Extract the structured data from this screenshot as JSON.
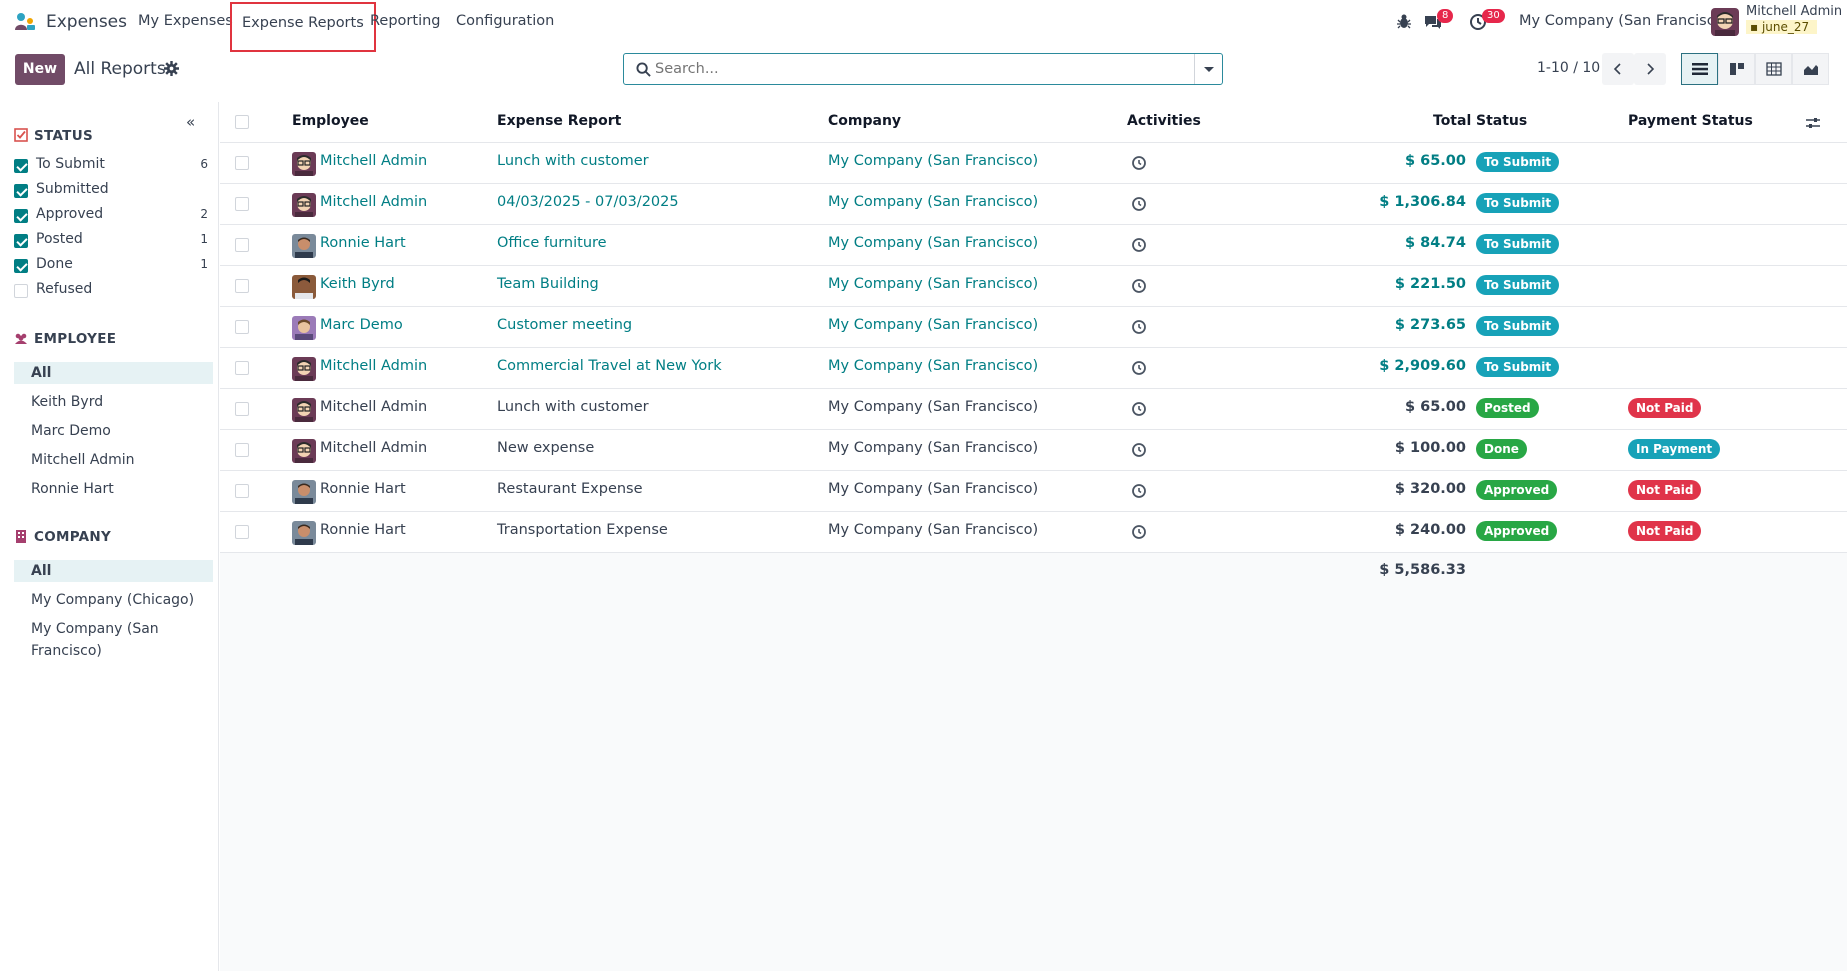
{
  "app": {
    "name": "Expenses",
    "menu": [
      "My Expenses",
      "Expense Reports",
      "Reporting",
      "Configuration"
    ],
    "active_menu": "Expense Reports"
  },
  "systray": {
    "messages_count": "8",
    "activities_count": "30",
    "company": "My Company (San Francisco)",
    "user_name": "Mitchell Admin",
    "database": "june_27"
  },
  "control": {
    "new_label": "New",
    "title": "All Reports",
    "search_placeholder": "Search...",
    "pager": "1-10 / 10"
  },
  "sidebar": {
    "status_title": "STATUS",
    "status_items": [
      {
        "label": "To Submit",
        "count": "6",
        "checked": true
      },
      {
        "label": "Submitted",
        "count": "",
        "checked": true
      },
      {
        "label": "Approved",
        "count": "2",
        "checked": true
      },
      {
        "label": "Posted",
        "count": "1",
        "checked": true
      },
      {
        "label": "Done",
        "count": "1",
        "checked": true
      },
      {
        "label": "Refused",
        "count": "",
        "checked": false
      }
    ],
    "employee_title": "EMPLOYEE",
    "employee_items": [
      "All",
      "Keith Byrd",
      "Marc Demo",
      "Mitchell Admin",
      "Ronnie Hart"
    ],
    "company_title": "COMPANY",
    "company_items": [
      "All",
      "My Company (Chicago)",
      "My Company (San Francisco)"
    ]
  },
  "table": {
    "headers": {
      "employee": "Employee",
      "report": "Expense Report",
      "company": "Company",
      "activities": "Activities",
      "total": "Total",
      "status": "Status",
      "payment": "Payment Status"
    },
    "rows": [
      {
        "employee": "Mitchell Admin",
        "avatar": "mitchell",
        "report": "Lunch with customer",
        "company": "My Company (San Francisco)",
        "total": "$ 65.00",
        "status": "To Submit",
        "status_kind": "tosubmit",
        "payment": "",
        "payment_kind": "",
        "link": true
      },
      {
        "employee": "Mitchell Admin",
        "avatar": "mitchell",
        "report": "04/03/2025 - 07/03/2025",
        "company": "My Company (San Francisco)",
        "total": "$ 1,306.84",
        "status": "To Submit",
        "status_kind": "tosubmit",
        "payment": "",
        "payment_kind": "",
        "link": true
      },
      {
        "employee": "Ronnie Hart",
        "avatar": "ronnie",
        "report": "Office furniture",
        "company": "My Company (San Francisco)",
        "total": "$ 84.74",
        "status": "To Submit",
        "status_kind": "tosubmit",
        "payment": "",
        "payment_kind": "",
        "link": true
      },
      {
        "employee": "Keith Byrd",
        "avatar": "keith",
        "report": "Team Building",
        "company": "My Company (San Francisco)",
        "total": "$ 221.50",
        "status": "To Submit",
        "status_kind": "tosubmit",
        "payment": "",
        "payment_kind": "",
        "link": true
      },
      {
        "employee": "Marc Demo",
        "avatar": "marc",
        "report": "Customer meeting",
        "company": "My Company (San Francisco)",
        "total": "$ 273.65",
        "status": "To Submit",
        "status_kind": "tosubmit",
        "payment": "",
        "payment_kind": "",
        "link": true
      },
      {
        "employee": "Mitchell Admin",
        "avatar": "mitchell",
        "report": "Commercial Travel at New York",
        "company": "My Company (San Francisco)",
        "total": "$ 2,909.60",
        "status": "To Submit",
        "status_kind": "tosubmit",
        "payment": "",
        "payment_kind": "",
        "link": true
      },
      {
        "employee": "Mitchell Admin",
        "avatar": "mitchell",
        "report": "Lunch with customer",
        "company": "My Company (San Francisco)",
        "total": "$ 65.00",
        "status": "Posted",
        "status_kind": "posted",
        "payment": "Not Paid",
        "payment_kind": "notpaid",
        "link": false
      },
      {
        "employee": "Mitchell Admin",
        "avatar": "mitchell",
        "report": "New expense",
        "company": "My Company (San Francisco)",
        "total": "$ 100.00",
        "status": "Done",
        "status_kind": "done",
        "payment": "In Payment",
        "payment_kind": "inpayment",
        "link": false
      },
      {
        "employee": "Ronnie Hart",
        "avatar": "ronnie",
        "report": "Restaurant Expense",
        "company": "My Company (San Francisco)",
        "total": "$ 320.00",
        "status": "Approved",
        "status_kind": "approved",
        "payment": "Not Paid",
        "payment_kind": "notpaid",
        "link": false
      },
      {
        "employee": "Ronnie Hart",
        "avatar": "ronnie",
        "report": "Transportation Expense",
        "company": "My Company (San Francisco)",
        "total": "$ 240.00",
        "status": "Approved",
        "status_kind": "approved",
        "payment": "Not Paid",
        "payment_kind": "notpaid",
        "link": false
      }
    ],
    "grand_total": "$ 5,586.33"
  }
}
